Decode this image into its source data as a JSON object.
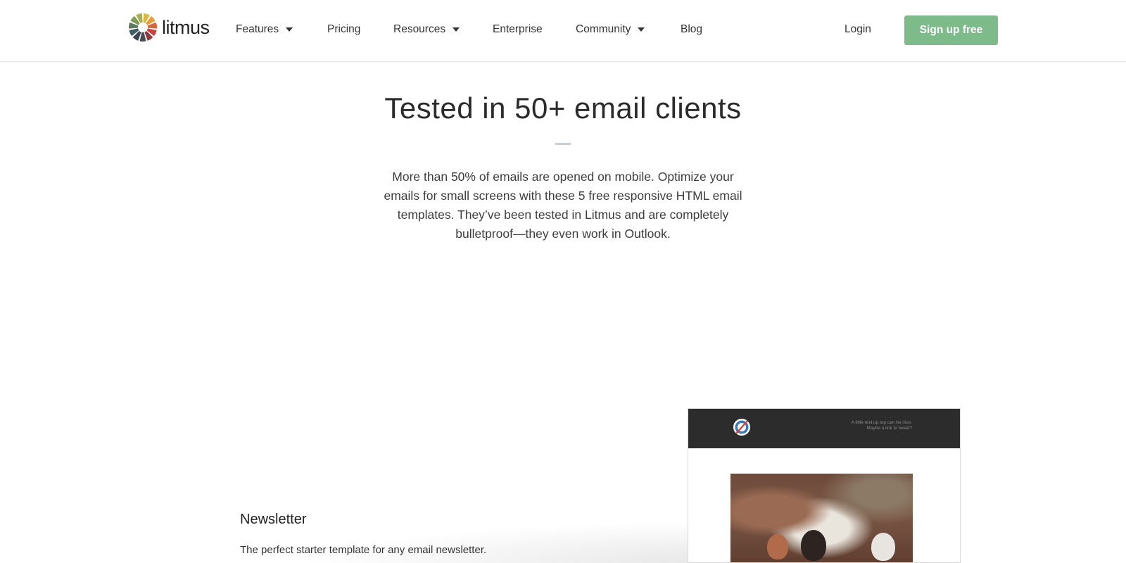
{
  "brand": {
    "name": "litmus",
    "colors": [
      "#d9b844",
      "#e79c3d",
      "#d8653a",
      "#c8433b",
      "#8e3b3d",
      "#4b4b55",
      "#394754",
      "#3f5b64",
      "#5f7a5f",
      "#7f9c55",
      "#a9b14a"
    ]
  },
  "nav": {
    "items": [
      {
        "label": "Features",
        "has_dropdown": true
      },
      {
        "label": "Pricing",
        "has_dropdown": false
      },
      {
        "label": "Resources",
        "has_dropdown": true
      },
      {
        "label": "Enterprise",
        "has_dropdown": false
      },
      {
        "label": "Community",
        "has_dropdown": true
      },
      {
        "label": "Blog",
        "has_dropdown": false
      }
    ],
    "login_label": "Login",
    "signup_label": "Sign up free",
    "signup_color": "#7dbb8b"
  },
  "hero": {
    "title": "Tested in 50+ email clients",
    "body": "More than 50% of emails are opened on mobile. Optimize your emails for small screens with these 5 free responsive HTML email templates. They’ve been tested in Litmus and are completely bulletproof—they even work in Outlook."
  },
  "template": {
    "name": "Newsletter",
    "description": "The perfect starter template for any email newsletter.",
    "preview": {
      "top_note_line1": "A little text up top can be nice.",
      "top_note_line2": "Maybe a link to tweet?",
      "header_color": "#2c2c2c"
    }
  }
}
